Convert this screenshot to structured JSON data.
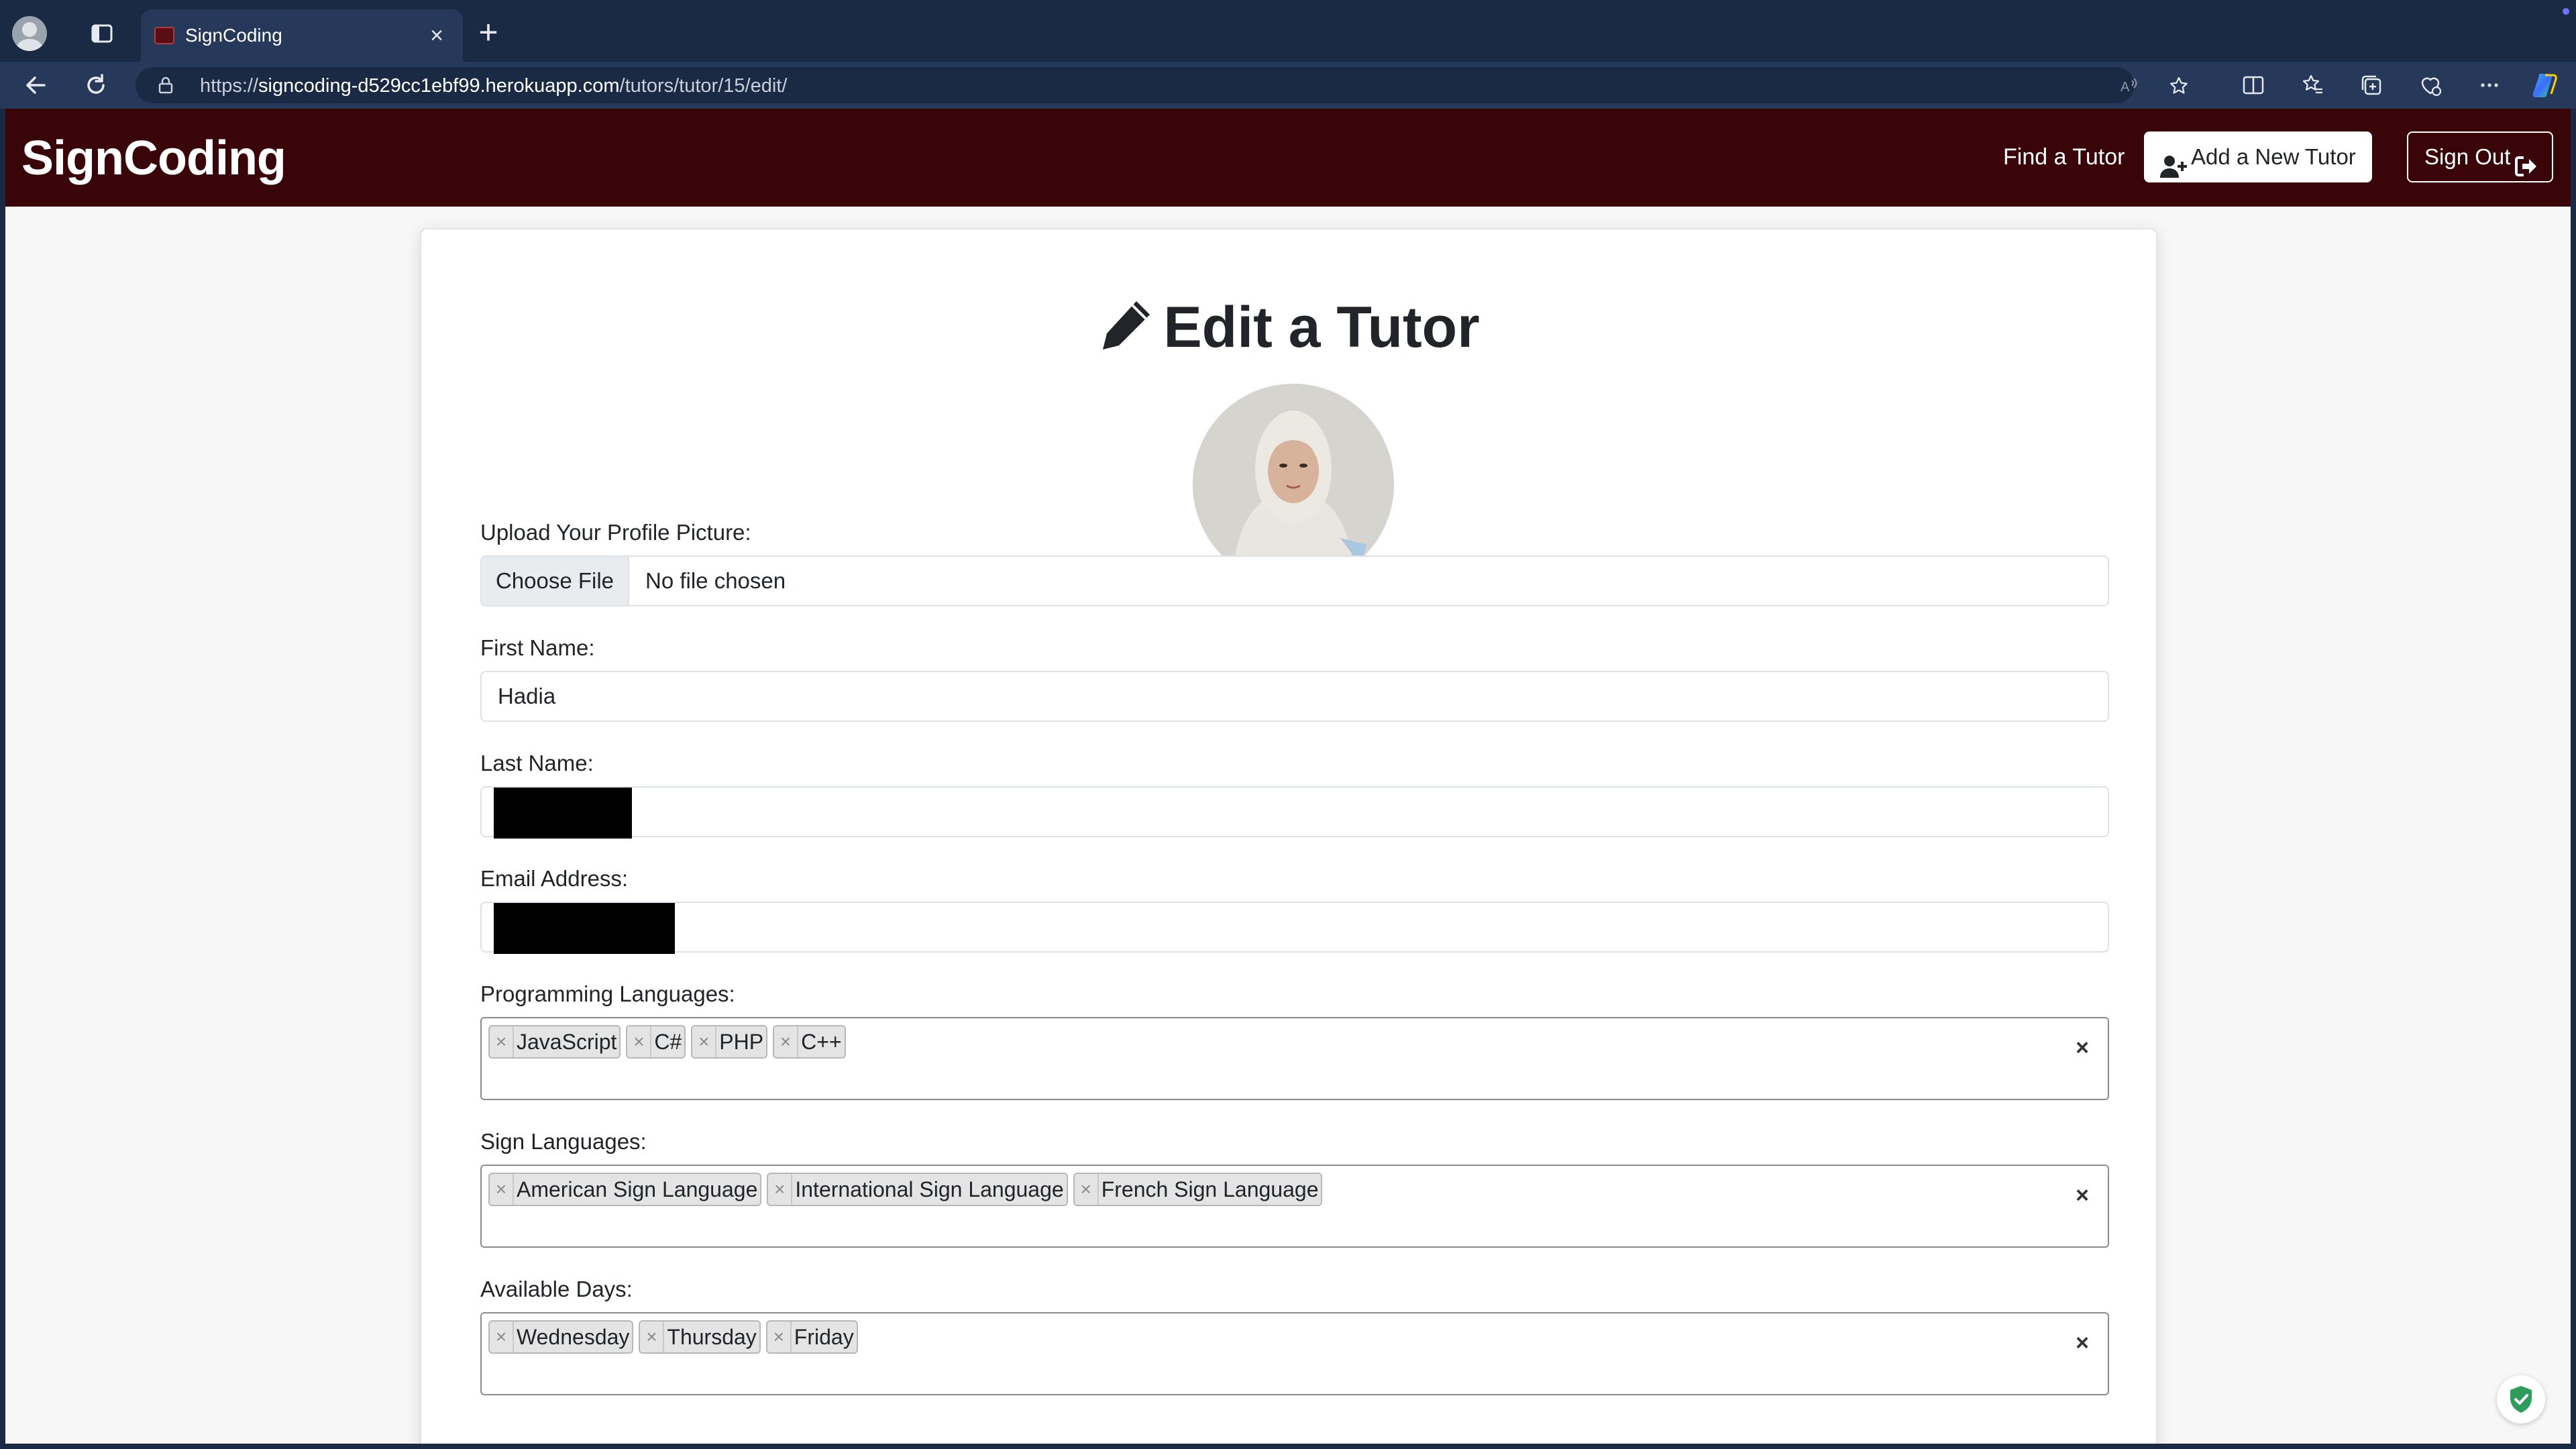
{
  "browser": {
    "tab_title": "SignCoding",
    "url_secure_prefix": "https://",
    "url_host": "signcoding-d529cc1ebf99.herokuapp.com",
    "url_path": "/tutors/tutor/15/edit/"
  },
  "navbar": {
    "brand": "SignCoding",
    "find_tutor": "Find a Tutor",
    "add_tutor": "Add a New Tutor",
    "sign_out": "Sign Out"
  },
  "form": {
    "heading": "Edit a Tutor",
    "profile_picture": {
      "label": "Upload Your Profile Picture:",
      "button": "Choose File",
      "status": "No file chosen"
    },
    "first_name": {
      "label": "First Name:",
      "value": "Hadia"
    },
    "last_name": {
      "label": "Last Name:"
    },
    "email": {
      "label": "Email Address:"
    },
    "programming_languages": {
      "label": "Programming Languages:",
      "selected": [
        "JavaScript",
        "C#",
        "PHP",
        "C++"
      ]
    },
    "sign_languages": {
      "label": "Sign Languages:",
      "selected": [
        "American Sign Language",
        "International Sign Language",
        "French Sign Language"
      ]
    },
    "available_days": {
      "label": "Available Days:",
      "selected": [
        "Wednesday",
        "Thursday",
        "Friday"
      ]
    }
  },
  "colors": {
    "navbar_bg": "#3a0509",
    "browser_chrome": "#1b2a44",
    "page_bg": "#f7f7f7",
    "security_badge": "#2e9d5b"
  },
  "icons": {
    "heading": "pencil-icon",
    "add_tutor": "user-plus-icon",
    "sign_out": "sign-out-icon"
  }
}
